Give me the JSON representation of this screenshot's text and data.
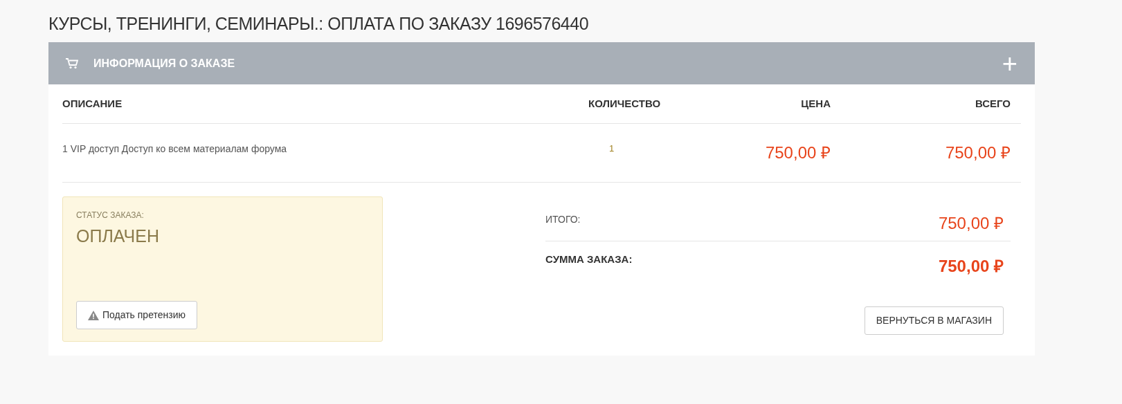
{
  "page_title": "КУРСЫ, ТРЕНИНГИ, СЕМИНАРЫ.: ОПЛАТА ПО ЗАКАЗУ 1696576440",
  "panel": {
    "title": "ИНФОРМАЦИЯ О ЗАКАЗЕ",
    "expand_icon": "+"
  },
  "table": {
    "columns": [
      "ОПИСАНИЕ",
      "КОЛИЧЕСТВО",
      "ЦЕНА",
      "ВСЕГО"
    ],
    "rows": [
      {
        "description": "1 VIP доступ Доступ ко всем материалам форума",
        "quantity": "1",
        "price": "750,00 ₽",
        "total": "750,00 ₽"
      }
    ]
  },
  "status": {
    "label": "СТАТУС ЗАКАЗА:",
    "value": "ОПЛАЧЕН",
    "button": "Подать претензию"
  },
  "totals": [
    {
      "label": "ИТОГО:",
      "value": "750,00 ₽",
      "kind": "subtotal"
    },
    {
      "label": "СУММА ЗАКАЗА:",
      "value": "750,00 ₽",
      "kind": "grand"
    }
  ],
  "return_button": "ВЕРНУТЬСЯ В МАГАЗИН"
}
